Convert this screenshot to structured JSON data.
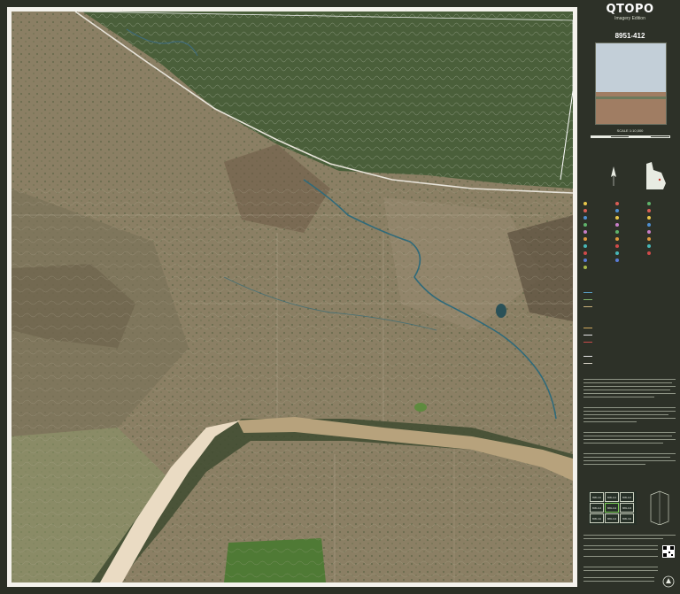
{
  "panel": {
    "title": "QTOPO",
    "edition": "Imagery Edition",
    "sheet_number": "8951-412",
    "scale": "SCALE 1:10,000"
  },
  "index_map": {
    "sheets": [
      "8951-111",
      "8951-112",
      "8951-113",
      "8951-114",
      "8951-411",
      "8951-412",
      "8951-413",
      "8951-414",
      "8951-311"
    ]
  },
  "colors": {
    "background": "#2b2f25",
    "panel": "#2d3128",
    "title": "#ffffff",
    "river": "#b9a27a",
    "sandbank": "#e8d7bf",
    "forest": "#3f5a33",
    "grassland": "#8c8164"
  },
  "icons": [
    "qld-map-icon",
    "north-arrow-icon",
    "qr-code-icon",
    "government-crest-icon"
  ]
}
